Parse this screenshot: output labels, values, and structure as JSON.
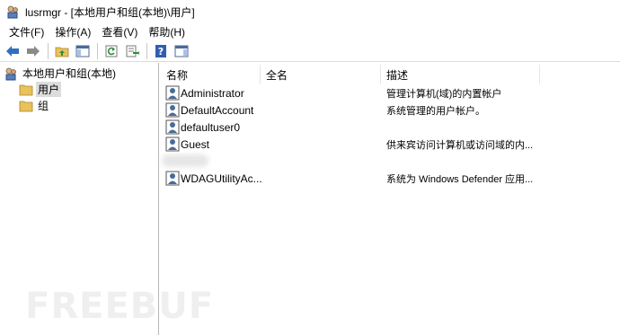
{
  "window": {
    "title": "lusrmgr - [本地用户和组(本地)\\用户]",
    "app_icon": "users-computer-icon"
  },
  "menu": [
    "文件(F)",
    "操作(A)",
    "查看(V)",
    "帮助(H)"
  ],
  "toolbar": {
    "buttons": [
      "back-arrow-icon",
      "forward-arrow-icon",
      "up-folder-icon",
      "show-hide-tree-icon",
      "refresh-icon",
      "export-list-icon",
      "help-icon",
      "action-pane-icon"
    ]
  },
  "tree": {
    "root": "本地用户和组(本地)",
    "items": [
      {
        "label": "用户",
        "selected": true
      },
      {
        "label": "组",
        "selected": false
      }
    ]
  },
  "list": {
    "columns": [
      "名称",
      "全名",
      "描述"
    ],
    "rows": [
      {
        "name": "Administrator",
        "fullname": "",
        "description": "管理计算机(域)的内置帐户"
      },
      {
        "name": "DefaultAccount",
        "fullname": "",
        "description": "系统管理的用户帐户。"
      },
      {
        "name": "defaultuser0",
        "fullname": "",
        "description": ""
      },
      {
        "name": "Guest",
        "fullname": "",
        "description": "供来宾访问计算机或访问域的内..."
      },
      {
        "name": "",
        "fullname": "",
        "description": ""
      },
      {
        "name": "WDAGUtilityAc...",
        "fullname": "",
        "description": "系统为 Windows Defender 应用..."
      }
    ]
  },
  "watermark": "FREEBUF",
  "colors": {
    "folder": "#e8c25a",
    "arrow_blue": "#2f6fc0",
    "selection": "#dcdcdc"
  }
}
